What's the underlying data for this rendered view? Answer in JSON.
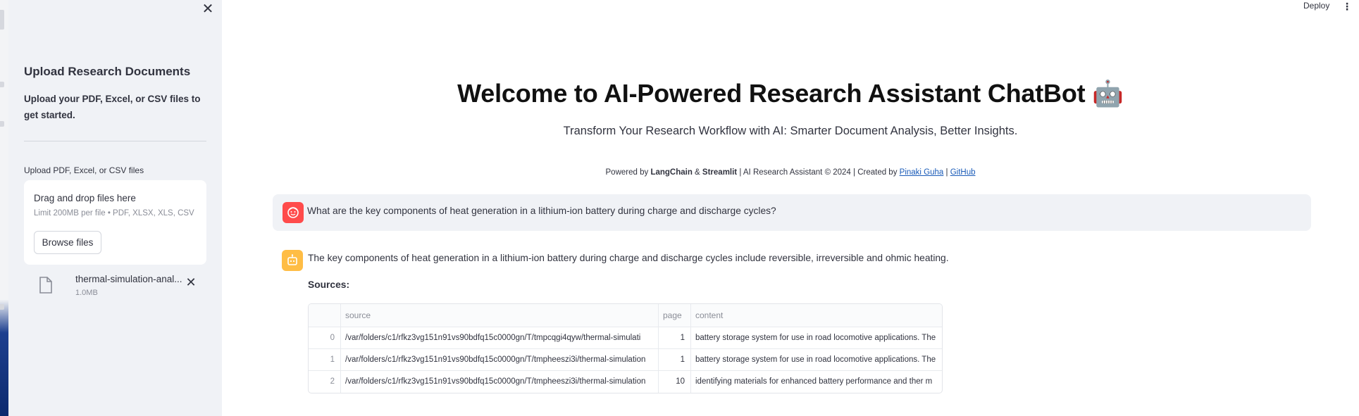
{
  "sidebar": {
    "close_glyph": "✕",
    "title": "Upload Research Documents",
    "description": "Upload your PDF, Excel, or CSV files to get started.",
    "uploader_label": "Upload PDF, Excel, or CSV files",
    "dropzone_title": "Drag and drop files here",
    "dropzone_limit": "Limit 200MB per file • PDF, XLSX, XLS, CSV",
    "browse_label": "Browse files",
    "file": {
      "name": "thermal-simulation-anal...",
      "size": "1.0MB",
      "remove_glyph": "✕"
    }
  },
  "header": {
    "deploy_label": "Deploy",
    "menu_glyph": "⋮"
  },
  "main": {
    "title": "Welcome to AI-Powered Research Assistant ChatBot 🤖",
    "subtitle": "Transform Your Research Workflow with AI: Smarter Document Analysis, Better Insights.",
    "footer": {
      "p1": "Powered by ",
      "langchain": "LangChain",
      "amp": " & ",
      "streamlit": "Streamlit",
      "p2": " | AI Research Assistant © 2024 | Created by ",
      "author": "Pinaki Guha",
      "sep": " | ",
      "github": "GitHub"
    }
  },
  "chat": {
    "user_message": "What are the key components of heat generation in a lithium-ion battery during charge and discharge cycles?",
    "bot_message": "The key components of heat generation in a lithium-ion battery during charge and discharge cycles include reversible, irreversible and ohmic heating.",
    "sources_label": "Sources:",
    "table": {
      "columns": [
        "",
        "source",
        "page",
        "content"
      ],
      "rows": [
        [
          "0",
          "/var/folders/c1/rfkz3vg151n91vs90bdfq15c0000gn/T/tmpcqgi4qyw/thermal-simulati",
          "1",
          "battery storage system for use in road locomotive applications. The"
        ],
        [
          "1",
          "/var/folders/c1/rfkz3vg151n91vs90bdfq15c0000gn/T/tmpheeszi3i/thermal-simulation",
          "1",
          "battery storage system for use in road locomotive applications. The"
        ],
        [
          "2",
          "/var/folders/c1/rfkz3vg151n91vs90bdfq15c0000gn/T/tmpheeszi3i/thermal-simulation",
          "10",
          "identifying materials for enhanced battery performance and ther m"
        ]
      ]
    }
  },
  "colors": {
    "user_avatar": "#ff4b4b",
    "bot_avatar": "#ffbd45",
    "link": "#1a5bb8",
    "sidebar_bg": "#f0f2f6"
  },
  "icons": [
    "close-icon",
    "file-icon",
    "remove-file-icon",
    "more-menu-icon",
    "user-avatar-icon",
    "bot-avatar-icon"
  ]
}
